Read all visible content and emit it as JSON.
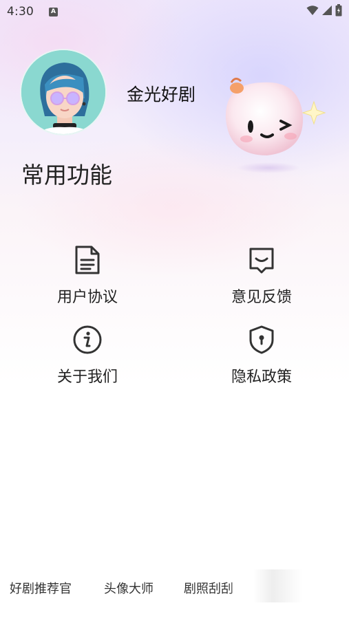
{
  "status_bar": {
    "time": "4:30",
    "badge": "A",
    "icons": [
      "wifi-icon",
      "signal-icon",
      "battery-icon"
    ]
  },
  "profile": {
    "name": "金光好剧",
    "avatar": "avatar-icon"
  },
  "section": {
    "title": "常用功能"
  },
  "functions": [
    {
      "label": "用户协议",
      "icon": "document-icon"
    },
    {
      "label": "意见反馈",
      "icon": "feedback-icon"
    },
    {
      "label": "关于我们",
      "icon": "info-icon"
    },
    {
      "label": "隐私政策",
      "icon": "shield-icon"
    }
  ],
  "bottom_tabs": [
    {
      "label": "好剧推荐官"
    },
    {
      "label": "头像大师"
    },
    {
      "label": "剧照刮刮"
    }
  ],
  "colors": {
    "text": "#222222",
    "icon_stroke": "#333333",
    "avatar_bg": "#8ad8d0"
  }
}
